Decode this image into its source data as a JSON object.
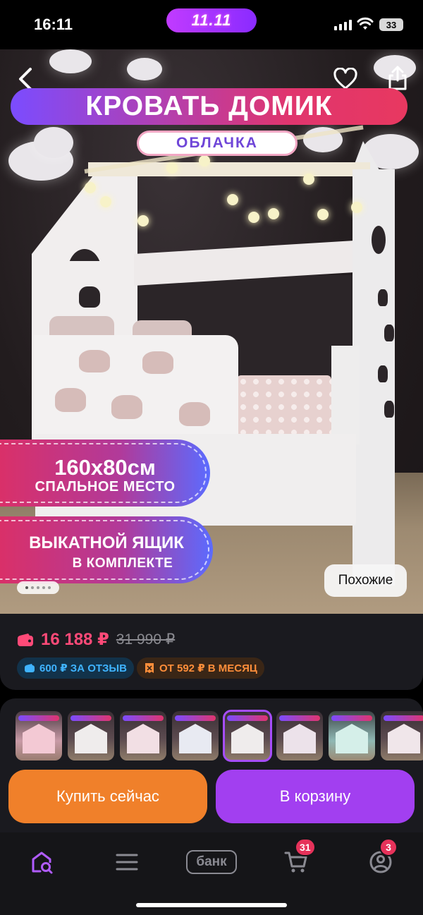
{
  "status_bar": {
    "time": "16:11",
    "promo": "11.11",
    "battery": "33"
  },
  "hero": {
    "title": "КРОВАТЬ ДОМИК",
    "subtitle": "ОБЛАЧКА",
    "badge1_line1": "160x80см",
    "badge1_line2": "СПАЛЬНОЕ МЕСТО",
    "badge2_line1": "ВЫКАТНОЙ ЯЩИК",
    "badge2_line2": "В КОМПЛЕКТЕ",
    "similar_label": "Похожие",
    "slides_total": 5,
    "slide_index": 1
  },
  "price": {
    "current": "16 188 ₽",
    "old": "31 990 ₽",
    "review_bonus": "600 ₽ ЗА ОТЗЫВ",
    "installment": "ОТ 592 ₽ В МЕСЯЦ"
  },
  "variants": {
    "count": 8,
    "selected_index": 4
  },
  "actions": {
    "buy_now": "Купить сейчас",
    "to_cart": "В корзину"
  },
  "tabbar": {
    "bank_label": "банк",
    "cart_badge": "31",
    "profile_badge": "3"
  },
  "colors": {
    "price": "#ff4a78",
    "buy_button": "#f0802a",
    "cart_button": "#a23ff0",
    "accent_purple": "#a64dff"
  }
}
